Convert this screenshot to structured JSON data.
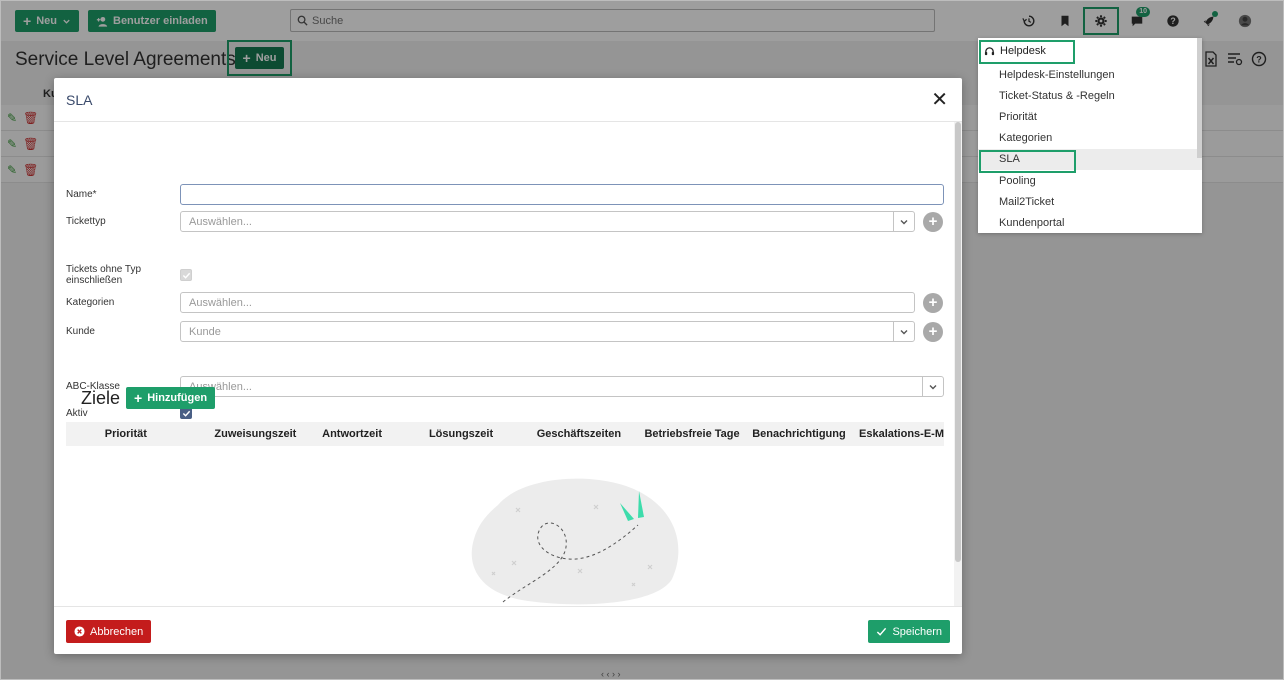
{
  "topbar": {
    "new_label": "Neu",
    "invite_label": "Benutzer einladen",
    "search_placeholder": "Suche",
    "chat_badge": "10"
  },
  "page": {
    "title": "Service Level Agreements",
    "new_label": "Neu",
    "table_col_first": "Ku"
  },
  "modal": {
    "title": "SLA",
    "fields": {
      "name_label": "Name*",
      "tickettyp_label": "Tickettyp",
      "tickettyp_placeholder": "Auswählen...",
      "ohne_typ_label": "Tickets ohne Typ einschließen",
      "kategorien_label": "Kategorien",
      "kategorien_placeholder": "Auswählen...",
      "kunde_label": "Kunde",
      "kunde_placeholder": "Kunde",
      "abc_label": "ABC-Klasse",
      "abc_placeholder": "Auswählen...",
      "aktiv_label": "Aktiv"
    },
    "ziele": {
      "title": "Ziele",
      "add_label": "Hinzufügen",
      "columns": [
        "Priorität",
        "Zuweisungszeit",
        "Antwortzeit",
        "Lösungszeit",
        "Geschäftszeiten",
        "Betriebsfreie Tage",
        "Benachrichtigung",
        "Eskalations-E-M"
      ]
    },
    "cancel_label": "Abbrechen",
    "save_label": "Speichern"
  },
  "menu": {
    "header": "Helpdesk",
    "items": [
      "Helpdesk-Einstellungen",
      "Ticket-Status & -Regeln",
      "Priorität",
      "Kategorien",
      "SLA",
      "Pooling",
      "Mail2Ticket",
      "Kundenportal"
    ],
    "selected": "SLA"
  },
  "colors": {
    "accent": "#1e9e6a",
    "danger": "#c41c1c",
    "checkbox": "#4a5f85"
  }
}
